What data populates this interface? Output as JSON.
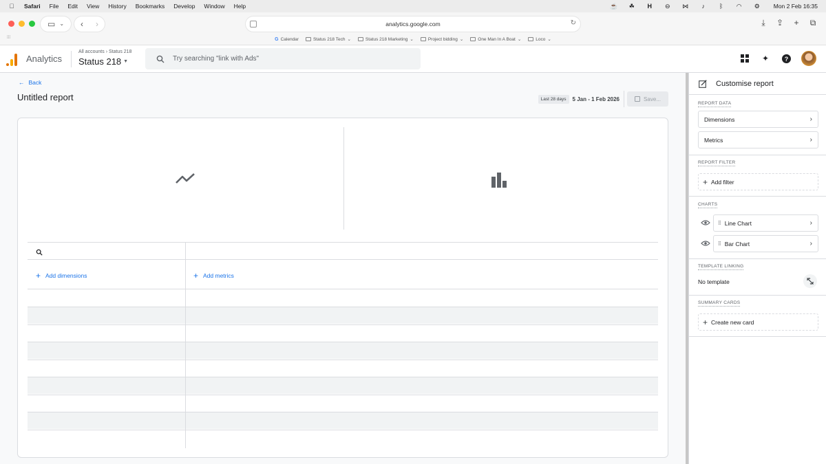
{
  "menubar": {
    "apple": "",
    "items": [
      "Safari",
      "File",
      "Edit",
      "View",
      "History",
      "Bookmarks",
      "Develop",
      "Window",
      "Help"
    ],
    "clock": "Mon 2 Feb  16:35"
  },
  "browser": {
    "url": "analytics.google.com",
    "bookmarks": [
      "Calendar",
      "Status 218 Tech",
      "Status 218 Marketing",
      "Project bidding",
      "One Man In A Boat",
      "Loco"
    ]
  },
  "header": {
    "product": "Analytics",
    "crumb_all": "All accounts",
    "crumb_account": "Status 218",
    "property": "Status 218",
    "search_placeholder": "Try searching \"link with Ads\""
  },
  "report": {
    "back_label": "Back",
    "title": "Untitled report",
    "date_chip": "Last 28 days",
    "date_range": "5 Jan - 1 Feb 2026",
    "save_label": "Save...",
    "add_dimensions": "Add dimensions",
    "add_metrics": "Add metrics"
  },
  "panel": {
    "title": "Customise report",
    "report_data_label": "REPORT DATA",
    "dimensions": "Dimensions",
    "metrics": "Metrics",
    "report_filter_label": "REPORT FILTER",
    "add_filter": "Add filter",
    "charts_label": "CHARTS",
    "charts": [
      "Line Chart",
      "Bar Chart"
    ],
    "template_linking_label": "TEMPLATE LINKING",
    "no_template": "No template",
    "summary_cards_label": "SUMMARY CARDS",
    "create_card": "Create new card"
  },
  "colors": {
    "accent": "#1a73e8",
    "logo_orange": "#e37400",
    "logo_yellow": "#f9ab00"
  }
}
